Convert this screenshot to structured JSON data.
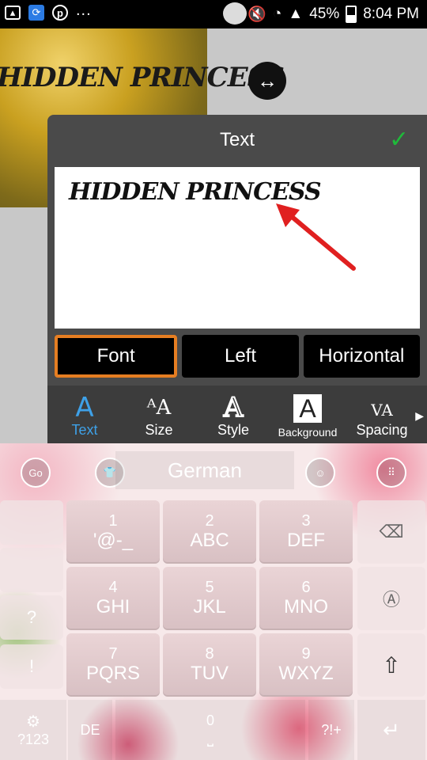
{
  "status_bar": {
    "battery": "45%",
    "time": "8:04 PM",
    "more": "..."
  },
  "canvas": {
    "overlay_text": "HIDDEN PRINCESS"
  },
  "dialog": {
    "title": "Text",
    "text_value": "HIDDEN PRINCESS",
    "options": [
      "Font",
      "Left",
      "Horizontal"
    ],
    "tools": [
      {
        "label": "Text",
        "icon": "text-icon"
      },
      {
        "label": "Size",
        "icon": "size-icon"
      },
      {
        "label": "Style",
        "icon": "style-icon"
      },
      {
        "label": "Background",
        "icon": "background-icon"
      },
      {
        "label": "Spacing",
        "icon": "spacing-icon"
      }
    ],
    "accent_color": "#e67e22",
    "active_tool_color": "#3ea1e8",
    "confirm_color": "#1fb93a"
  },
  "keyboard": {
    "language": "German",
    "top_left": "Go",
    "keys": [
      {
        "num": "1",
        "letters": "'@-_"
      },
      {
        "num": "2",
        "letters": "ABC"
      },
      {
        "num": "3",
        "letters": "DEF"
      },
      {
        "num": "4",
        "letters": "GHI"
      },
      {
        "num": "5",
        "letters": "JKL"
      },
      {
        "num": "6",
        "letters": "MNO"
      },
      {
        "num": "7",
        "letters": "PQRS"
      },
      {
        "num": "8",
        "letters": "TUV"
      },
      {
        "num": "9",
        "letters": "WXYZ"
      }
    ],
    "side_question": "?",
    "side_exclaim": "!",
    "bottom_mode": "?123",
    "bottom_lang": "DE",
    "bottom_zero": "0",
    "bottom_symbols": "?!+"
  }
}
